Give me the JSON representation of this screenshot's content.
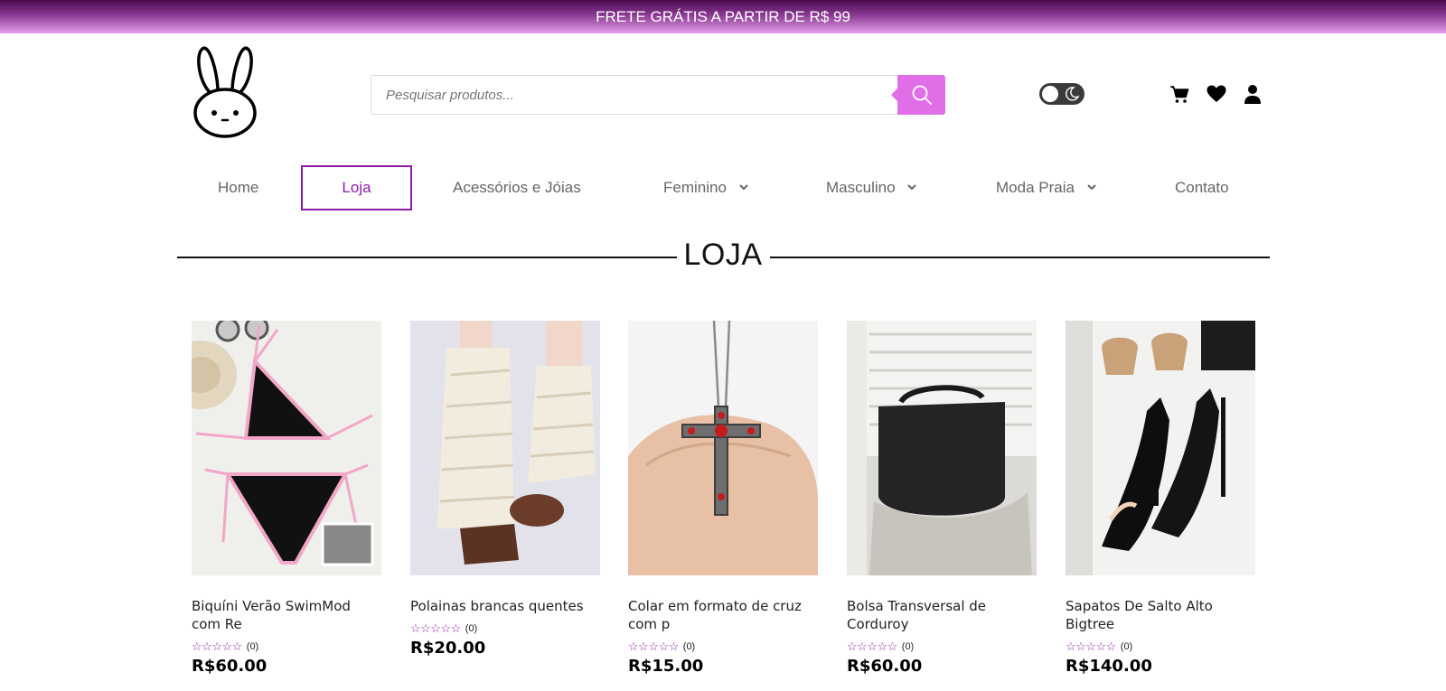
{
  "announcement": "FRETE GRÁTIS A PARTIR DE R$ 99",
  "search": {
    "placeholder": "Pesquisar produtos..."
  },
  "header_icons": [
    "cart-icon",
    "heart-icon",
    "user-icon"
  ],
  "theme_toggle": {
    "state": "light"
  },
  "nav": {
    "items": [
      {
        "label": "Home"
      },
      {
        "label": "Loja",
        "active": true
      },
      {
        "label": "Acessórios e Jóias"
      },
      {
        "label": "Feminino",
        "dropdown": true
      },
      {
        "label": "Masculino",
        "dropdown": true
      },
      {
        "label": "Moda Praia",
        "dropdown": true
      },
      {
        "label": "Contato"
      }
    ]
  },
  "page_title": "LOJA",
  "products": [
    {
      "title": "Biquíni Verão SwimMod com Re",
      "rating_count": "(0)",
      "price": "R$60.00"
    },
    {
      "title": "Polainas brancas quentes",
      "rating_count": "(0)",
      "price": "R$20.00"
    },
    {
      "title": "Colar em formato de cruz com p",
      "rating_count": "(0)",
      "price": "R$15.00"
    },
    {
      "title": "Bolsa Transversal de Corduroy",
      "rating_count": "(0)",
      "price": "R$60.00"
    },
    {
      "title": "Sapatos De Salto Alto Bigtree",
      "rating_count": "(0)",
      "price": "R$140.00"
    }
  ],
  "colors": {
    "accent": "#8e1aa8",
    "search_button": "#e06ee6",
    "topbar_dark": "#4a0a4e",
    "topbar_light": "#e39ee8"
  }
}
